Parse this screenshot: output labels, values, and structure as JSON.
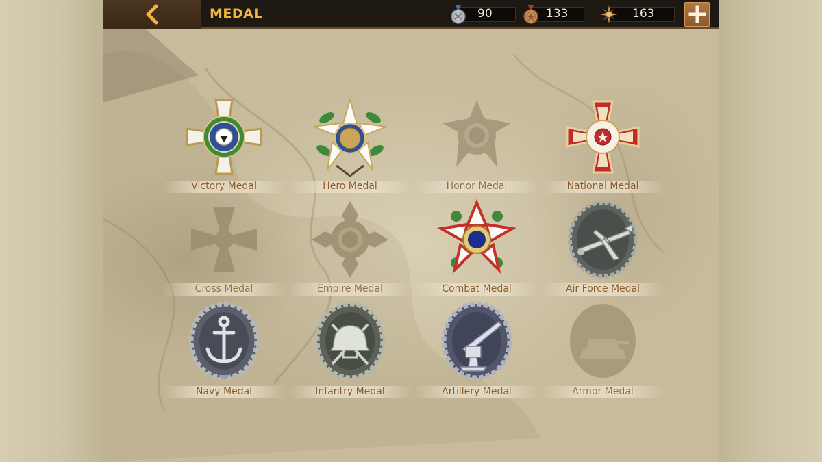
{
  "header": {
    "title": "MEDAL",
    "back_icon": "chevron-left-icon"
  },
  "currencies": [
    {
      "name": "silver-medal",
      "icon": "silver-medal-icon",
      "value": "90"
    },
    {
      "name": "bronze-medal",
      "icon": "bronze-medal-icon",
      "value": "133"
    },
    {
      "name": "star-badge",
      "icon": "star-badge-icon",
      "value": "163"
    }
  ],
  "add_button": {
    "icon": "plus-icon"
  },
  "medals": [
    {
      "label": "Victory Medal",
      "unlocked": true
    },
    {
      "label": "Hero Medal",
      "unlocked": true
    },
    {
      "label": "Honor Medal",
      "unlocked": false
    },
    {
      "label": "National Medal",
      "unlocked": true
    },
    {
      "label": "Cross Medal",
      "unlocked": false
    },
    {
      "label": "Empire Medal",
      "unlocked": false
    },
    {
      "label": "Combat Medal",
      "unlocked": true
    },
    {
      "label": "Air Force Medal",
      "unlocked": true
    },
    {
      "label": "Navy Medal",
      "unlocked": true
    },
    {
      "label": "Infantry Medal",
      "unlocked": true
    },
    {
      "label": "Artillery Medal",
      "unlocked": true
    },
    {
      "label": "Armor Medal",
      "unlocked": false
    }
  ],
  "colors": {
    "title": "#f0b53c",
    "label": "#8c5a26",
    "topbar": "#1e1812",
    "plus_button": "#a06a36"
  }
}
